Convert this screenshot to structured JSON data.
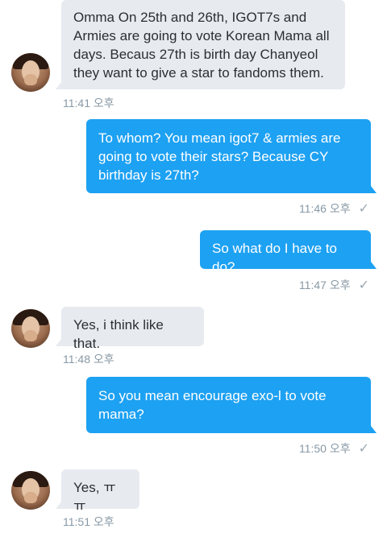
{
  "messages": [
    {
      "direction": "in",
      "text": "Omma On 25th and 26th, IGOT7s and Armies are going to vote Korean Mama all days. Becaus 27th is birth day Chanyeol they want to give a star to fandoms them.",
      "time": "11:41 오후"
    },
    {
      "direction": "out",
      "text": "To whom? You mean igot7 & armies are going to vote their stars? Because CY birthday is 27th?",
      "time": "11:46 오후"
    },
    {
      "direction": "out",
      "text": "So what do I have to do?",
      "time": "11:47 오후"
    },
    {
      "direction": "in",
      "text": "Yes, i think like that.",
      "time": "11:48 오후"
    },
    {
      "direction": "out",
      "text": "So you mean encourage exo-l to vote mama?",
      "time": "11:50 오후"
    },
    {
      "direction": "in",
      "text": "Yes, ㅠㅠ",
      "time": "11:51 오후"
    }
  ],
  "status_icon": "checkmark-icon",
  "colors": {
    "outgoing": "#1da1f2",
    "incoming": "#e7ebef",
    "timestamp": "#8899a6"
  }
}
